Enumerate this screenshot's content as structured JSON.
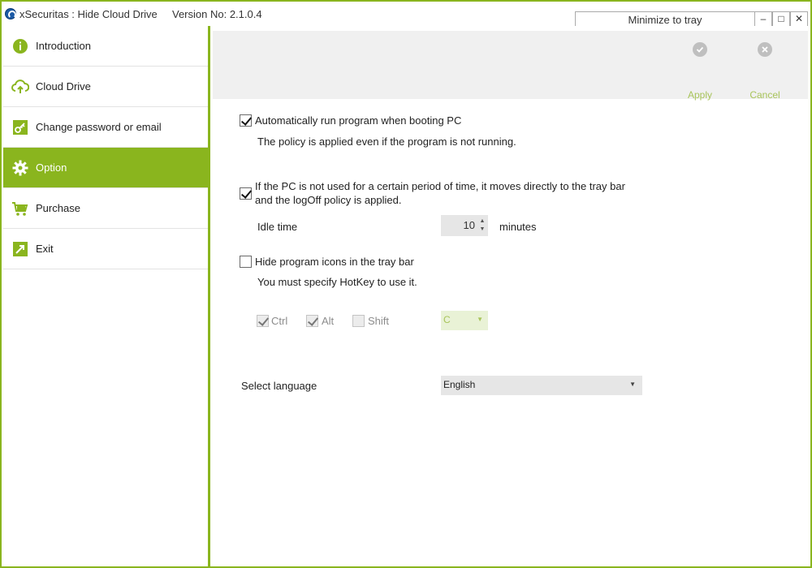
{
  "window": {
    "app_title": "xSecuritas : Hide Cloud Drive",
    "version": "Version No: 2.1.0.4",
    "minimize_to_tray": "Minimize to tray",
    "min_glyph": "–",
    "max_glyph": "□",
    "close_glyph": "✕"
  },
  "sidebar": {
    "items": [
      {
        "label": "Introduction",
        "icon": "info-icon",
        "active": false
      },
      {
        "label": "Cloud Drive",
        "icon": "cloud-icon",
        "active": false
      },
      {
        "label": "Change password or email",
        "icon": "key-icon",
        "active": false
      },
      {
        "label": "Option",
        "icon": "gear-icon",
        "active": true
      },
      {
        "label": "Purchase",
        "icon": "cart-icon",
        "active": false
      },
      {
        "label": "Exit",
        "icon": "exit-icon",
        "active": false
      }
    ]
  },
  "actions": {
    "apply_label": "Apply",
    "cancel_label": "Cancel"
  },
  "options": {
    "auto_run": {
      "label": "Automatically run program when booting PC",
      "checked": true,
      "description": "The policy is applied even if the program is not running."
    },
    "idle_policy": {
      "label_line1": "If the PC is not used for a certain period of time, it moves directly to the tray bar",
      "label_line2": "and the logOff policy is applied.",
      "checked": true,
      "idle_label": "Idle time",
      "idle_value": "10",
      "idle_unit": "minutes"
    },
    "hide_icons": {
      "label": "Hide program icons in the tray bar",
      "checked": false,
      "description": "You must specify HotKey to use it."
    },
    "hotkey": {
      "ctrl_label": "Ctrl",
      "ctrl_checked": true,
      "alt_label": "Alt",
      "alt_checked": true,
      "shift_label": "Shift",
      "shift_checked": false,
      "key_value": "C"
    },
    "language": {
      "label": "Select language",
      "value": "English"
    }
  },
  "colors": {
    "accent": "#8ab51e",
    "accent_light_text": "#a8c45a",
    "action_bar_bg": "#f0f0f0"
  }
}
